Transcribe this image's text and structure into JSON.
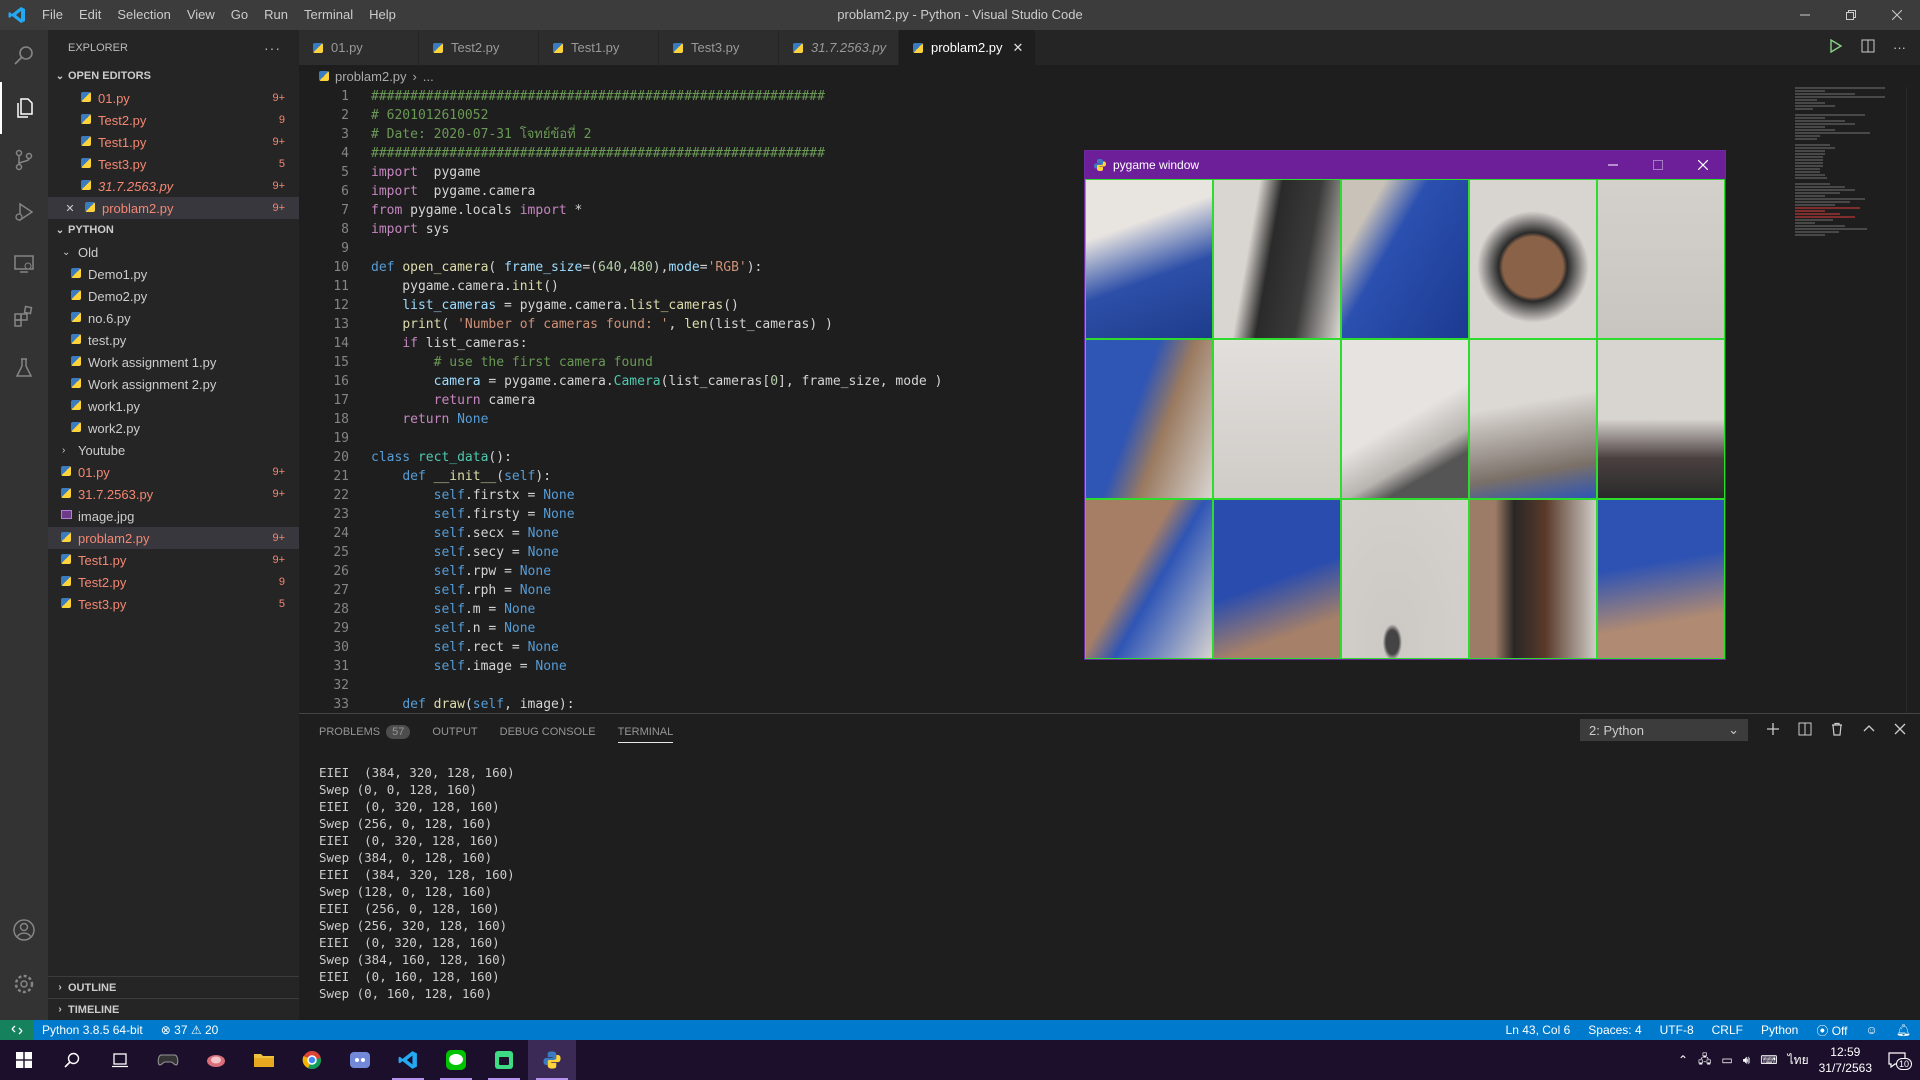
{
  "window": {
    "title": "problam2.py - Python - Visual Studio Code"
  },
  "menu": [
    "File",
    "Edit",
    "Selection",
    "View",
    "Go",
    "Run",
    "Terminal",
    "Help"
  ],
  "explorer": {
    "title": "EXPLORER",
    "open_editors_label": "OPEN EDITORS",
    "open_editors": [
      {
        "name": "01.py",
        "badge": "9+"
      },
      {
        "name": "Test2.py",
        "badge": "9"
      },
      {
        "name": "Test1.py",
        "badge": "9+"
      },
      {
        "name": "Test3.py",
        "badge": "5"
      },
      {
        "name": "31.7.2563.py",
        "badge": "9+"
      },
      {
        "name": "problam2.py",
        "badge": "9+"
      }
    ],
    "folder_label": "PYTHON",
    "subfolder_old": "Old",
    "old_files": [
      "Demo1.py",
      "Demo2.py",
      "no.6.py",
      "test.py",
      "Work assignment 1.py",
      "Work assignment 2.py",
      "work1.py",
      "work2.py"
    ],
    "subfolder_youtube": "Youtube",
    "files": [
      {
        "name": "01.py",
        "badge": "9+",
        "err": true
      },
      {
        "name": "31.7.2563.py",
        "badge": "9+",
        "err": true
      },
      {
        "name": "image.jpg",
        "badge": "",
        "err": false
      },
      {
        "name": "problam2.py",
        "badge": "9+",
        "err": true
      },
      {
        "name": "Test1.py",
        "badge": "9+",
        "err": true
      },
      {
        "name": "Test2.py",
        "badge": "9",
        "err": true
      },
      {
        "name": "Test3.py",
        "badge": "5",
        "err": true
      }
    ],
    "outline_label": "OUTLINE",
    "timeline_label": "TIMELINE"
  },
  "tabs": [
    {
      "name": "01.py",
      "italic": false,
      "active": false
    },
    {
      "name": "Test2.py",
      "italic": false,
      "active": false
    },
    {
      "name": "Test1.py",
      "italic": false,
      "active": false
    },
    {
      "name": "Test3.py",
      "italic": false,
      "active": false
    },
    {
      "name": "31.7.2563.py",
      "italic": true,
      "active": false
    },
    {
      "name": "problam2.py",
      "italic": false,
      "active": true
    }
  ],
  "breadcrumb": {
    "file": "problam2.py",
    "rest": "..."
  },
  "code_lines": [
    [
      [
        "cm",
        "##########################################################"
      ]
    ],
    [
      [
        "cm",
        "# 6201012610052"
      ]
    ],
    [
      [
        "cm",
        "# Date: 2020-07-31 โจทย์ข้อที่ 2"
      ]
    ],
    [
      [
        "cm",
        "##########################################################"
      ]
    ],
    [
      [
        "kw",
        "import"
      ],
      [
        "",
        "  pygame"
      ]
    ],
    [
      [
        "kw",
        "import"
      ],
      [
        "",
        "  pygame.camera"
      ]
    ],
    [
      [
        "kw",
        "from"
      ],
      [
        "",
        " pygame.locals "
      ],
      [
        "kw",
        "import"
      ],
      [
        "",
        " *"
      ]
    ],
    [
      [
        "kw",
        "import"
      ],
      [
        "",
        " sys"
      ]
    ],
    [
      [
        "",
        ""
      ]
    ],
    [
      [
        "def",
        "def"
      ],
      [
        "",
        " "
      ],
      [
        "fn",
        "open_camera"
      ],
      [
        "",
        "( "
      ],
      [
        "var",
        "frame_size"
      ],
      [
        "",
        "=("
      ],
      [
        "num",
        "640"
      ],
      [
        "",
        ","
      ],
      [
        "num",
        "480"
      ],
      [
        "",
        "),"
      ],
      [
        "var",
        "mode"
      ],
      [
        "",
        "="
      ],
      [
        "str",
        "'RGB'"
      ],
      [
        "",
        "):"
      ]
    ],
    [
      [
        "",
        "    pygame.camera."
      ],
      [
        "fn",
        "init"
      ],
      [
        "",
        "()"
      ]
    ],
    [
      [
        "",
        "    "
      ],
      [
        "var",
        "list_cameras"
      ],
      [
        "",
        " = pygame.camera."
      ],
      [
        "fn",
        "list_cameras"
      ],
      [
        "",
        "()"
      ]
    ],
    [
      [
        "",
        "    "
      ],
      [
        "fn",
        "print"
      ],
      [
        "",
        "( "
      ],
      [
        "str",
        "'Number of cameras found: '"
      ],
      [
        "",
        ", "
      ],
      [
        "fn",
        "len"
      ],
      [
        "",
        "(list_cameras) )"
      ]
    ],
    [
      [
        "",
        "    "
      ],
      [
        "kw",
        "if"
      ],
      [
        "",
        " list_cameras:"
      ]
    ],
    [
      [
        "",
        "        "
      ],
      [
        "cm",
        "# use the first camera found"
      ]
    ],
    [
      [
        "",
        "        "
      ],
      [
        "var",
        "camera"
      ],
      [
        "",
        " = pygame.camera."
      ],
      [
        "cls",
        "Camera"
      ],
      [
        "",
        "(list_cameras["
      ],
      [
        "num",
        "0"
      ],
      [
        "",
        "], frame_size, mode )"
      ]
    ],
    [
      [
        "",
        "        "
      ],
      [
        "kw",
        "return"
      ],
      [
        "",
        " camera"
      ]
    ],
    [
      [
        "",
        "    "
      ],
      [
        "kw",
        "return"
      ],
      [
        " def",
        " None"
      ]
    ],
    [
      [
        "",
        ""
      ]
    ],
    [
      [
        "def",
        "class"
      ],
      [
        "",
        " "
      ],
      [
        "cls",
        "rect_data"
      ],
      [
        "",
        "():"
      ]
    ],
    [
      [
        "",
        "    "
      ],
      [
        "def",
        "def"
      ],
      [
        "",
        " "
      ],
      [
        "fn",
        "__init__"
      ],
      [
        "",
        "("
      ],
      [
        "slf",
        "self"
      ],
      [
        "",
        "):"
      ]
    ],
    [
      [
        "",
        "        "
      ],
      [
        "slf",
        "self"
      ],
      [
        "",
        ".firstx = "
      ],
      [
        "def",
        "None"
      ]
    ],
    [
      [
        "",
        "        "
      ],
      [
        "slf",
        "self"
      ],
      [
        "",
        ".firsty = "
      ],
      [
        "def",
        "None"
      ]
    ],
    [
      [
        "",
        "        "
      ],
      [
        "slf",
        "self"
      ],
      [
        "",
        ".secx = "
      ],
      [
        "def",
        "None"
      ]
    ],
    [
      [
        "",
        "        "
      ],
      [
        "slf",
        "self"
      ],
      [
        "",
        ".secy = "
      ],
      [
        "def",
        "None"
      ]
    ],
    [
      [
        "",
        "        "
      ],
      [
        "slf",
        "self"
      ],
      [
        "",
        ".rpw = "
      ],
      [
        "def",
        "None"
      ]
    ],
    [
      [
        "",
        "        "
      ],
      [
        "slf",
        "self"
      ],
      [
        "",
        ".rph = "
      ],
      [
        "def",
        "None"
      ]
    ],
    [
      [
        "",
        "        "
      ],
      [
        "slf",
        "self"
      ],
      [
        "",
        ".m = "
      ],
      [
        "def",
        "None"
      ]
    ],
    [
      [
        "",
        "        "
      ],
      [
        "slf",
        "self"
      ],
      [
        "",
        ".n = "
      ],
      [
        "def",
        "None"
      ]
    ],
    [
      [
        "",
        "        "
      ],
      [
        "slf",
        "self"
      ],
      [
        "",
        ".rect = "
      ],
      [
        "def",
        "None"
      ]
    ],
    [
      [
        "",
        "        "
      ],
      [
        "slf",
        "self"
      ],
      [
        "",
        ".image = "
      ],
      [
        "def",
        "None"
      ]
    ],
    [
      [
        "",
        ""
      ]
    ],
    [
      [
        "",
        "    "
      ],
      [
        "def",
        "def"
      ],
      [
        "",
        " "
      ],
      [
        "fn",
        "draw"
      ],
      [
        "",
        "("
      ],
      [
        "slf",
        "self"
      ],
      [
        "",
        ", image):"
      ]
    ]
  ],
  "panel": {
    "tabs": [
      "PROBLEMS",
      "OUTPUT",
      "DEBUG CONSOLE",
      "TERMINAL"
    ],
    "problems_count": "57",
    "terminal_selector": "2: Python",
    "terminal_lines": [
      "EIEI  (384, 320, 128, 160)",
      "Swep (0, 0, 128, 160)",
      "EIEI  (0, 320, 128, 160)",
      "Swep (256, 0, 128, 160)",
      "EIEI  (0, 320, 128, 160)",
      "Swep (384, 0, 128, 160)",
      "EIEI  (384, 320, 128, 160)",
      "Swep (128, 0, 128, 160)",
      "EIEI  (256, 0, 128, 160)",
      "Swep (256, 320, 128, 160)",
      "EIEI  (0, 320, 128, 160)",
      "Swep (384, 160, 128, 160)",
      "EIEI  (0, 160, 128, 160)",
      "Swep (0, 160, 128, 160)"
    ]
  },
  "pygame": {
    "title": "pygame window"
  },
  "status": {
    "interpreter": "Python 3.8.5 64-bit",
    "errors": "37",
    "warnings": "20",
    "position": "Ln 43, Col 6",
    "spaces": "Spaces: 4",
    "encoding": "UTF-8",
    "eol": "CRLF",
    "language": "Python",
    "liveshare": "Off"
  },
  "taskbar": {
    "time": "12:59",
    "date": "31/7/2563",
    "lang": "ไทย",
    "notif": "10"
  },
  "colors": {
    "accent": "#007acc",
    "titlebar": "#3c3c3c",
    "pygame_title": "#6d1f9a",
    "grid_line": "#2ddc2d",
    "error": "#f48771"
  }
}
